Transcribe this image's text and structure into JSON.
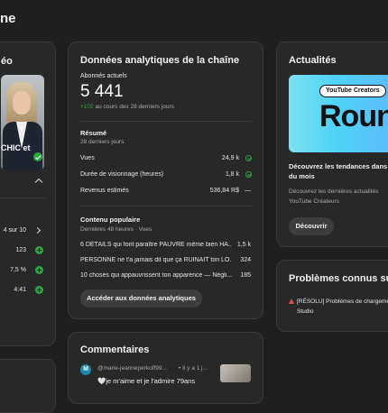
{
  "header": {
    "title": "ne"
  },
  "left_card": {
    "title": "éo",
    "thumb_overlay": "CHIC et",
    "stats": [
      {
        "value": "4 sur 10"
      },
      {
        "value": "123"
      },
      {
        "value": "7,5 %"
      },
      {
        "value": "4:41"
      }
    ]
  },
  "analytics": {
    "title": "Données analytiques de la chaîne",
    "subs_label": "Abonnés actuels",
    "subs_value": "5 441",
    "subs_delta": "+102",
    "subs_delta_text": "au cours des 28 derniers jours",
    "summary_title": "Résumé",
    "summary_period": "28 derniers jours",
    "metrics": [
      {
        "label": "Vues",
        "value": "24,9 k"
      },
      {
        "label": "Durée de visionnage (heures)",
        "value": "1,8 k"
      },
      {
        "label": "Revenus estimés",
        "value": "536,84 R$"
      }
    ],
    "revenue_dash": "—",
    "popular_title": "Contenu populaire",
    "popular_period": "Dernières 48 heures · Vues",
    "popular": [
      {
        "title": "6 DÉTAILS qui font paraître PAUVRE même bien HA...",
        "views": "1,5 k"
      },
      {
        "title": "PERSONNE ne t'a jamais dit que ça RUINAIT ton LO...",
        "views": "324"
      },
      {
        "title": "10 choses qui appauvrissent ton apparence — Négli...",
        "views": "185"
      }
    ],
    "cta": "Accéder aux données analytiques"
  },
  "news": {
    "title": "Actualités",
    "banner_chip": "YouTube Creators",
    "banner_big": "Round",
    "headline": "Découvrez les tendances dans\ndu mois",
    "desc": "Découvrez les dernières actualités\nYouTube Créateurs",
    "button": "Découvrir"
  },
  "issues": {
    "title": "Problèmes connus sur Yo",
    "item": "[RÉSOLU] Problèmes de chargeme\nStudio"
  },
  "comments": {
    "title": "Commentaires",
    "author": "@marie-jeanneperkoff99...",
    "time": "• Il y a 1 j...",
    "text": "🤍je m'aime et je l'admire 79ans"
  },
  "colors": {
    "accent_green": "#2ba640",
    "card_bg": "#282828",
    "page_bg": "#1f1f1f"
  }
}
